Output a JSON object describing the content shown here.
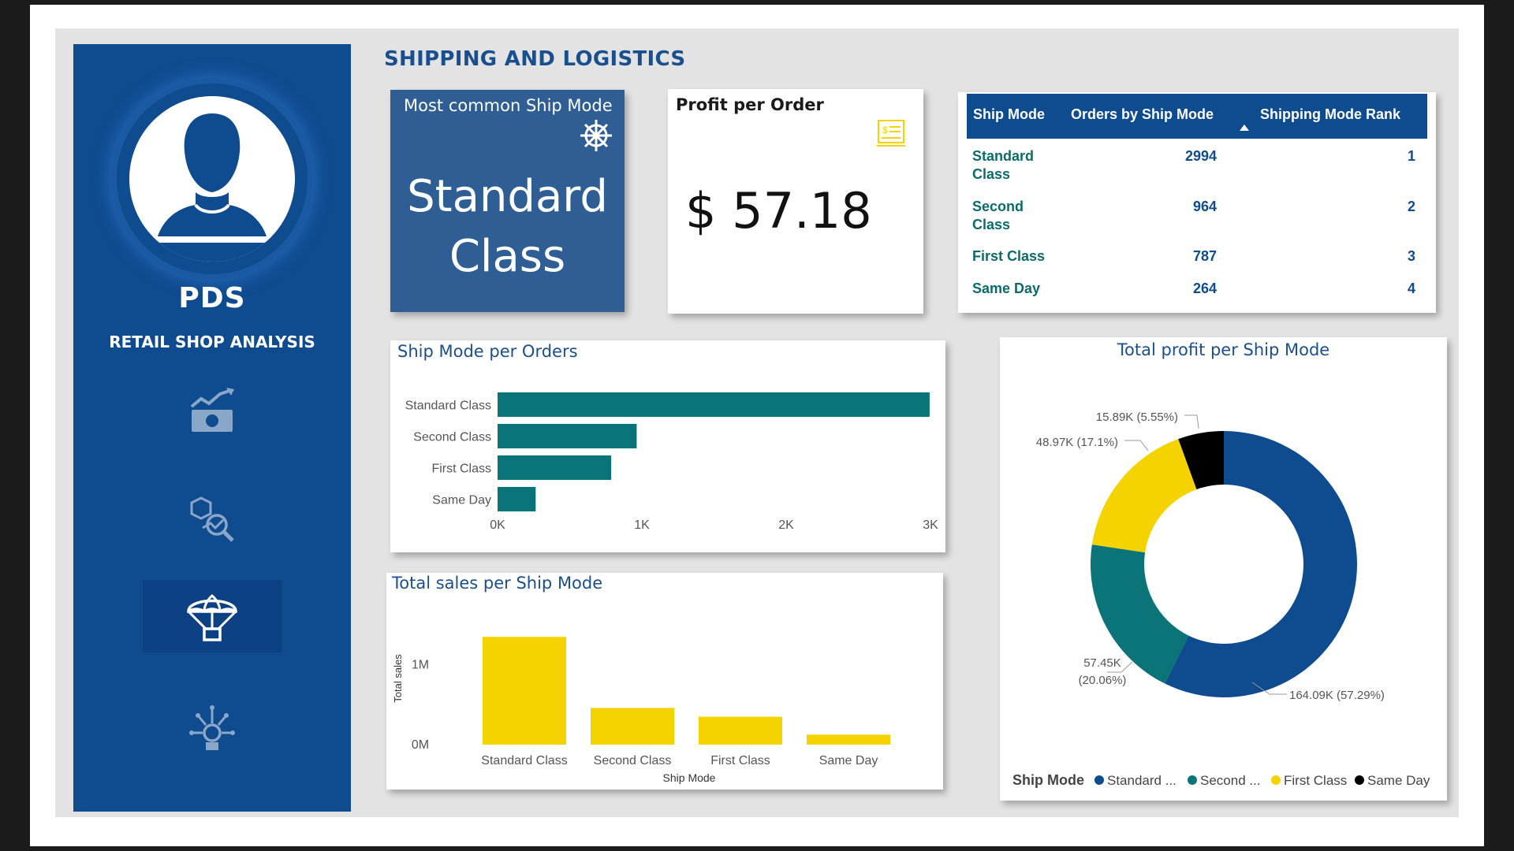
{
  "page": {
    "title": "SHIPPING AND LOGISTICS"
  },
  "sidebar": {
    "brand": "PDS",
    "subtitle": "RETAIL SHOP ANALYSIS",
    "nav": [
      {
        "icon": "sales-chart-icon",
        "active": false
      },
      {
        "icon": "product-analysis-icon",
        "active": false
      },
      {
        "icon": "parachute-delivery-icon",
        "active": true
      },
      {
        "icon": "idea-bulb-icon",
        "active": false
      }
    ]
  },
  "kpi_ship_mode": {
    "title": "Most common Ship Mode",
    "value_line1": "Standard",
    "value_line2": "Class",
    "icon": "ship-wheel-icon"
  },
  "kpi_profit": {
    "title": "Profit per Order",
    "value": "$ 57.18",
    "icon": "invoice-icon"
  },
  "table": {
    "headers": [
      "Ship Mode",
      "Orders by Ship Mode",
      "Shipping Mode Rank"
    ],
    "sort_column": 1,
    "rows": [
      {
        "mode_line1": "Standard",
        "mode_line2": "Class",
        "orders": "2994",
        "rank": "1"
      },
      {
        "mode_line1": "Second",
        "mode_line2": "Class",
        "orders": "964",
        "rank": "2"
      },
      {
        "mode_line1": "First Class",
        "mode_line2": "",
        "orders": "787",
        "rank": "3"
      },
      {
        "mode_line1": "Same Day",
        "mode_line2": "",
        "orders": "264",
        "rank": "4"
      }
    ]
  },
  "charts": {
    "orders_title": "Ship Mode per Orders",
    "sales_title": "Total sales per Ship Mode",
    "profit_title": "Total profit per Ship Mode"
  },
  "colors": {
    "navy": "#0f4b8f",
    "teal": "#0b7479",
    "yellow": "#f5d300",
    "black": "#000000"
  },
  "chart_data": [
    {
      "type": "bar",
      "orientation": "horizontal",
      "title": "Ship Mode per Orders",
      "categories": [
        "Standard Class",
        "Second Class",
        "First Class",
        "Same Day"
      ],
      "values": [
        2994,
        964,
        787,
        264
      ],
      "xlim": [
        0,
        3000
      ],
      "xticks": [
        "0K",
        "1K",
        "2K",
        "3K"
      ],
      "color": "#0b7479"
    },
    {
      "type": "bar",
      "title": "Total sales per Ship Mode",
      "categories": [
        "Standard Class",
        "Second Class",
        "First Class",
        "Same Day"
      ],
      "values": [
        1350000,
        460000,
        350000,
        125000
      ],
      "ylabel": "Total sales",
      "xlabel": "Ship Mode",
      "yticks": [
        "0M",
        "1M"
      ],
      "ylim": [
        0,
        1500000
      ],
      "color": "#f5d300"
    },
    {
      "type": "pie",
      "donut": true,
      "title": "Total profit per Ship Mode",
      "legend_title": "Ship Mode",
      "legend_labels": [
        "Standard ...",
        "Second ...",
        "First Class",
        "Same Day"
      ],
      "slices": [
        {
          "name": "Standard Class",
          "value": 164.09,
          "label": "164.09K (57.29%)",
          "color": "#0f4b8f"
        },
        {
          "name": "Second Class",
          "value": 57.45,
          "label_line1": "57.45K",
          "label_line2": "(20.06%)",
          "color": "#0b7479"
        },
        {
          "name": "First Class",
          "value": 48.97,
          "label": "48.97K (17.1%)",
          "color": "#f5d300"
        },
        {
          "name": "Same Day",
          "value": 15.89,
          "label": "15.89K (5.55%)",
          "color": "#000000"
        }
      ],
      "legend_position": "bottom"
    }
  ]
}
